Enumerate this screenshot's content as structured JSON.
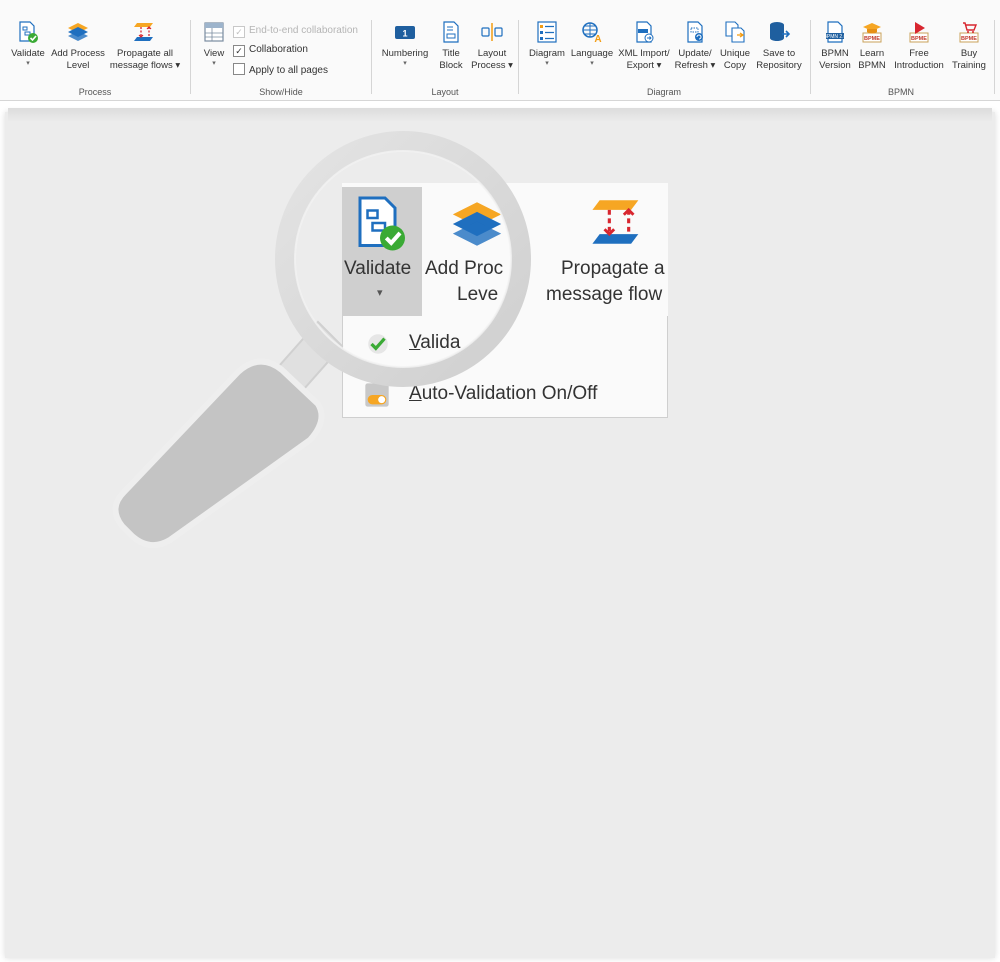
{
  "ribbon": {
    "groups": {
      "process": "Process",
      "show_hide": "Show/Hide",
      "layout": "Layout",
      "diagram": "Diagram",
      "bpmn": "BPMN"
    },
    "buttons": {
      "validate": [
        "Validate",
        ""
      ],
      "add_process_level": [
        "Add Process",
        "Level"
      ],
      "propagate": [
        "Propagate all",
        "message flows ▾"
      ],
      "view": [
        "View",
        ""
      ],
      "numbering": [
        "Numbering",
        ""
      ],
      "title_block": [
        "Title",
        "Block"
      ],
      "layout_process": [
        "Layout",
        "Process ▾"
      ],
      "diagram": [
        "Diagram",
        ""
      ],
      "language": [
        "Language",
        ""
      ],
      "xml_import": [
        "XML Import/",
        "Export ▾"
      ],
      "update_refresh": [
        "Update/",
        "Refresh ▾"
      ],
      "unique_copy": [
        "Unique",
        "Copy"
      ],
      "save_repo": [
        "Save to",
        "Repository"
      ],
      "bpmn_version": [
        "BPMN",
        "Version"
      ],
      "learn_bpmn": [
        "Learn",
        "BPMN"
      ],
      "free_intro": [
        "Free",
        "Introduction"
      ],
      "buy_training": [
        "Buy",
        "Training"
      ]
    },
    "checks": {
      "end_to_end": "End-to-end collaboration",
      "collaboration": "Collaboration",
      "apply_all": "Apply to all pages"
    },
    "dropdown_arrow": "▾"
  },
  "zoom": {
    "validate": "Validate",
    "add_process_1": "Add Proc",
    "add_process_2": "Leve",
    "propagate_1": "Propagate a",
    "propagate_2": "message flow",
    "menu": {
      "validate_letter": "V",
      "validate_rest": "alida",
      "auto_letter": "A",
      "auto_rest": "uto-Validation On/Off"
    }
  },
  "colors": {
    "accent_blue": "#1f6fbf",
    "check_green": "#3aaa35",
    "orange": "#f39c12",
    "red": "#d8262f",
    "ribbon_bg": "#fafafa",
    "canvas_bg": "#ececec"
  }
}
